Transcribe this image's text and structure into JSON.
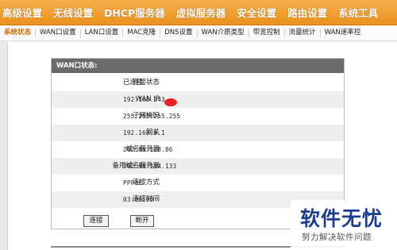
{
  "top_menu": [
    "高级设置",
    "无线设置",
    "DHCP服务器",
    "虚拟服务器",
    "安全设置",
    "路由设置",
    "系统工具"
  ],
  "sub_menu": [
    "系统状态",
    "WAN口设置",
    "LAN口设置",
    "MAC克隆",
    "DNS设置",
    "WAN介质类型",
    "带宽控制",
    "流量统计",
    "WAN速率控"
  ],
  "panel": {
    "title": "WAN口状态:",
    "rows": [
      {
        "label": "连接状态",
        "value": "已连接"
      },
      {
        "label": "WAN IP",
        "value": "192.168.243."
      },
      {
        "label": "子网掩码",
        "value": "255.255.255.255"
      },
      {
        "label": "网关",
        "value": "192.168.0.1"
      },
      {
        "label": "域名服务器",
        "value": "202.96.128.86"
      },
      {
        "label": "备用域名服务器",
        "value": "202.96.134.133"
      },
      {
        "label": "连接方式",
        "value": "PPPoE"
      },
      {
        "label": "连接时间",
        "value": "03:06:00"
      }
    ],
    "connect_label": "连接",
    "disconnect_label": "断开"
  },
  "watermark": {
    "title": "软件无忧",
    "subtitle": "努力解决软件问题"
  },
  "colors": {
    "menu_bar": "#f0a030",
    "panel_header": "#6a6a6a",
    "redaction": "#e8202a"
  }
}
